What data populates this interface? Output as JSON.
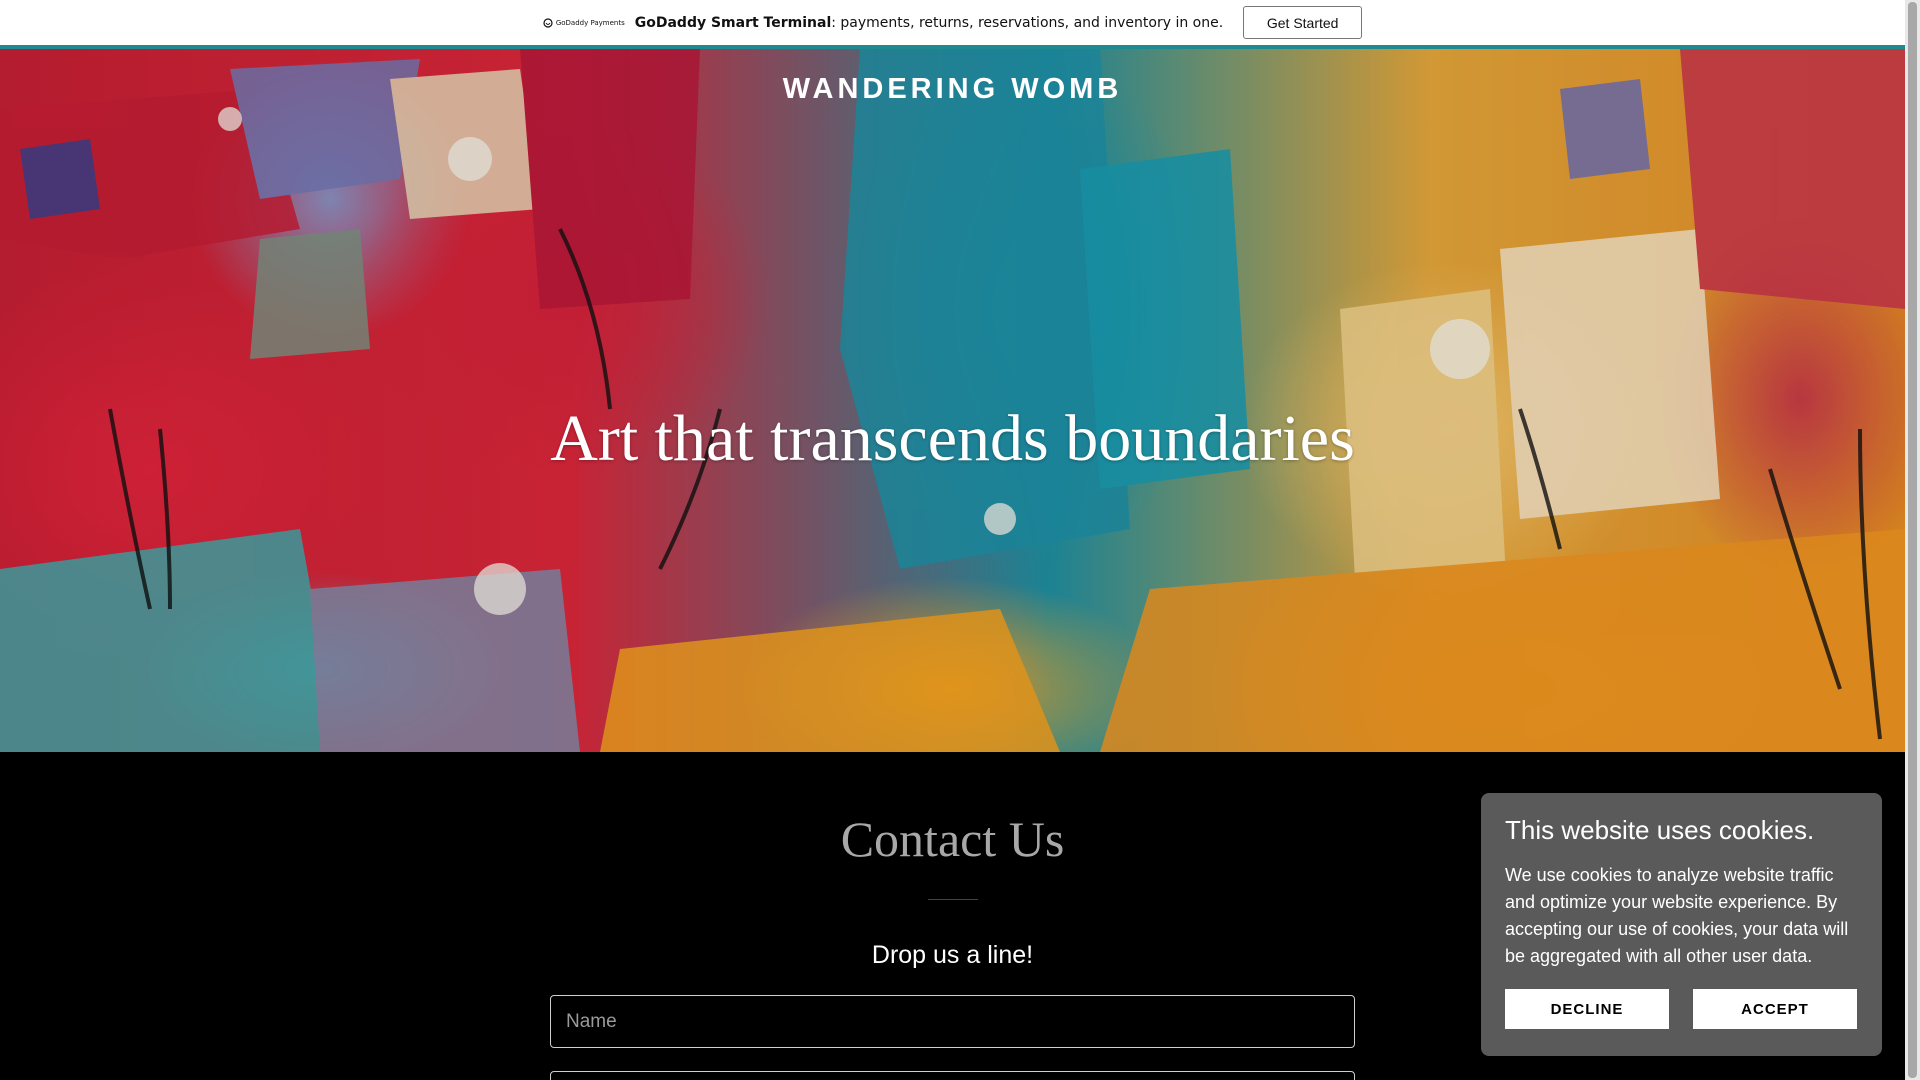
{
  "promo": {
    "logo_text": "GoDaddy Payments",
    "brand": "GoDaddy Smart Terminal",
    "message": ": payments, returns, reservations, and inventory in one.",
    "button_label": "Get Started"
  },
  "hero": {
    "site_title": "WANDERING WOMB",
    "tagline": "Art that transcends boundaries"
  },
  "contact": {
    "title": "Contact Us",
    "subtitle": "Drop us a line!",
    "name_placeholder": "Name",
    "email_placeholder": ""
  },
  "cookie": {
    "title": "This website uses cookies.",
    "text": "We use cookies to analyze website traffic and optimize your website experience. By accepting our use of cookies, your data will be aggregated with all other user data.",
    "decline_label": "DECLINE",
    "accept_label": "ACCEPT"
  },
  "colors": {
    "promo_border": "#1f8a8f",
    "cookie_bg": "#5a5a5a",
    "page_bg": "#000000"
  }
}
